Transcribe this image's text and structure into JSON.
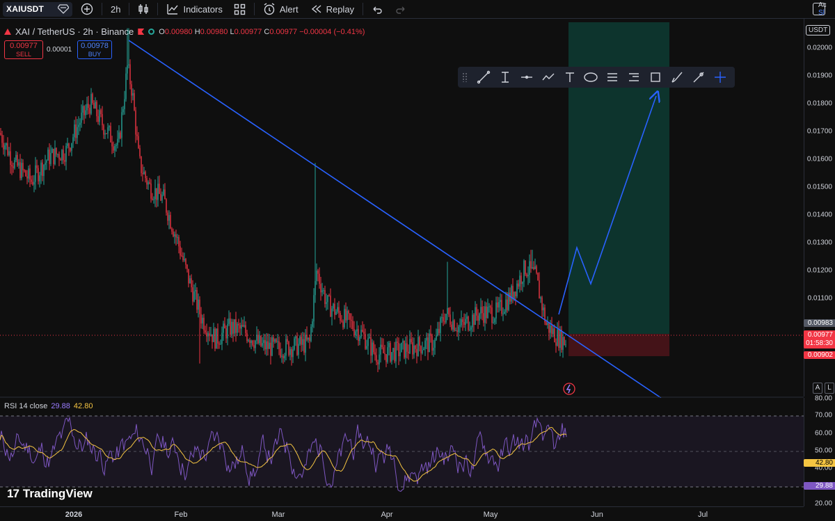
{
  "toolbar": {
    "symbol": "XAIUSDT",
    "interval": "2h",
    "indicators_label": "Indicators",
    "alert_label": "Alert",
    "replay_label": "Replay"
  },
  "legend": {
    "title": "XAI / TetherUS · 2h · Binance",
    "o_label": "O",
    "o_value": "0.00980",
    "h_label": "H",
    "h_value": "0.00980",
    "l_label": "L",
    "l_value": "0.00977",
    "c_label": "C",
    "c_value": "0.00977",
    "change": "−0.00004 (−0.41%)"
  },
  "trade": {
    "sell_price": "0.00977",
    "sell_label": "SELL",
    "spread": "0.00001",
    "buy_price": "0.00978",
    "buy_label": "BUY"
  },
  "drawing_tools": [
    "trend-line-icon",
    "ray-icon",
    "horizontal-line-icon",
    "path-icon",
    "text-icon",
    "ellipse-icon",
    "fib-icon",
    "position-icon",
    "rectangle-icon",
    "brush-icon",
    "measure-icon",
    "crosshair-icon"
  ],
  "price_axis": {
    "currency": "USDT",
    "labels": [
      "0.02000",
      "0.01900",
      "0.01800",
      "0.01700",
      "0.01600",
      "0.01500",
      "0.01400",
      "0.01300",
      "0.01200",
      "0.01100"
    ],
    "tag_target": "0.00983",
    "tag_current": "0.00977",
    "countdown": "01:58:30",
    "tag_stop": "0.00902",
    "auto_a": "A",
    "auto_l": "L"
  },
  "corner": {
    "line1": "Ac",
    "line2": "Sl"
  },
  "rsi": {
    "label": "RSI 14 close",
    "value": "29.88",
    "ma_value": "42.80",
    "axis_labels": [
      "80.00",
      "70.00",
      "60.00",
      "50.00",
      "40.00",
      "20.00"
    ],
    "tag_ma": "42.80",
    "tag_rsi": "29.88"
  },
  "time_axis": [
    "2026",
    "Feb",
    "Mar",
    "Apr",
    "May",
    "Jun",
    "Jul"
  ],
  "brand": "TradingView",
  "colors": {
    "up": "#26a69a",
    "down": "#f23645",
    "trend": "#2962ff",
    "rsi": "#7e57c2",
    "rsi_ma": "#f5c542",
    "target_zone": "#0d3b32",
    "stop_zone": "#4a1419"
  },
  "chart_data": {
    "type": "candlestick",
    "price_range": [
      0.008,
      0.0205
    ],
    "key_prices": [
      {
        "date": "2026-01",
        "price": 0.0165
      },
      {
        "date": "2026-01-17",
        "price": 0.0203
      },
      {
        "date": "2026-02-05",
        "price": 0.0109
      },
      {
        "date": "2026-02-10",
        "price": 0.0093
      },
      {
        "date": "2026-03-11",
        "price": 0.0159
      },
      {
        "date": "2026-03-25",
        "price": 0.0091
      },
      {
        "date": "2026-04-20",
        "price": 0.0125
      },
      {
        "date": "2026-05-08",
        "price": 0.0128
      },
      {
        "date": "2026-05-20",
        "price": 0.0098
      }
    ],
    "trendline": {
      "start": {
        "date": "2026-01-17",
        "price": 0.0201
      },
      "end": {
        "date": "2026-06-01",
        "price": 0.008
      }
    },
    "long_position": {
      "entry": 0.00977,
      "target": 0.0205,
      "stop": 0.00902
    },
    "projection": [
      0.0098,
      0.0129,
      0.0116,
      0.0184
    ],
    "rsi_range": [
      20,
      80
    ]
  }
}
